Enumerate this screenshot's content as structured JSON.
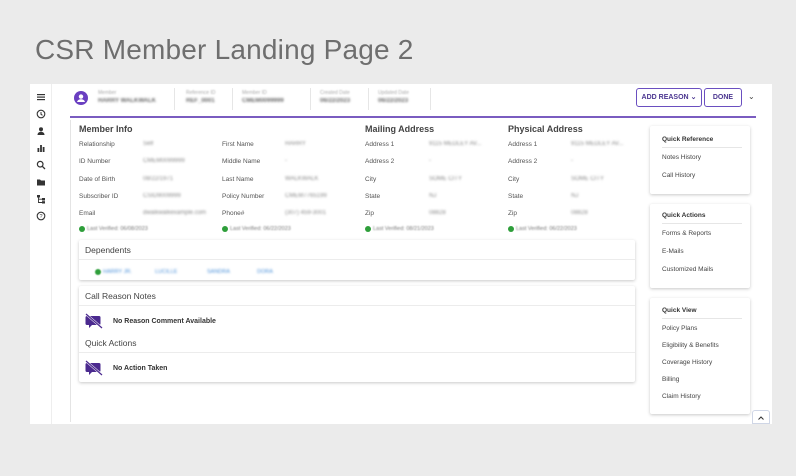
{
  "page_title": "CSR Member Landing Page 2",
  "header": {
    "fields": [
      {
        "label": "Member",
        "value": "HARRY WALKWALK"
      },
      {
        "label": "Reference ID",
        "value": "REF_0001"
      },
      {
        "label": "Member ID",
        "value": "CMEM0099999"
      },
      {
        "label": "Created Date",
        "value": "06/22/2023"
      },
      {
        "label": "Updated Date",
        "value": "06/22/2023"
      }
    ],
    "add_reason_label": "ADD REASON",
    "done_label": "DONE"
  },
  "member_info": {
    "title": "Member Info",
    "rows_left": [
      {
        "label": "Relationship",
        "value": "Self"
      },
      {
        "label": "ID Number",
        "value": "CMEM0099999"
      },
      {
        "label": "Date of Birth",
        "value": "08/22/1971"
      },
      {
        "label": "Subscriber ID",
        "value": "CSID9009999"
      },
      {
        "label": "Email",
        "value": "dwalkwalkexample.com"
      }
    ],
    "rows_right": [
      {
        "label": "First Name",
        "value": "HARRY"
      },
      {
        "label": "Middle Name",
        "value": "-"
      },
      {
        "label": "Last Name",
        "value": "WALKWALK"
      },
      {
        "label": "Policy Number",
        "value": "CMEM7765199"
      },
      {
        "label": "Phone#",
        "value": "(307) 459-3001"
      }
    ],
    "verified_left": "Last Verified: 06/08/2023",
    "verified_right": "Last Verified: 06/22/2023"
  },
  "mailing_address": {
    "title": "Mailing Address",
    "rows": [
      {
        "label": "Address 1",
        "value": "9115 MEDLEY AV..."
      },
      {
        "label": "Address 2",
        "value": "-"
      },
      {
        "label": "City",
        "value": "SOME CITY"
      },
      {
        "label": "State",
        "value": "NJ"
      },
      {
        "label": "Zip",
        "value": "08828"
      }
    ],
    "verified": "Last Verified: 08/21/2023"
  },
  "physical_address": {
    "title": "Physical Address",
    "rows": [
      {
        "label": "Address 1",
        "value": "9115 MEDLEY AV..."
      },
      {
        "label": "Address 2",
        "value": "-"
      },
      {
        "label": "City",
        "value": "SOME CITY"
      },
      {
        "label": "State",
        "value": "NJ"
      },
      {
        "label": "Zip",
        "value": "08828"
      }
    ],
    "verified": "Last Verified: 06/22/2023"
  },
  "dependents": {
    "title": "Dependents",
    "items": [
      "HARRY JR.",
      "LUCILLE",
      "SANDRA",
      "DORA"
    ]
  },
  "call_reason_notes": {
    "title": "Call Reason Notes",
    "empty_message": "No Reason Comment Available"
  },
  "quick_actions_main": {
    "title": "Quick Actions",
    "empty_message": "No Action Taken"
  },
  "side_quick_reference": {
    "title": "Quick Reference",
    "items": [
      "Notes History",
      "Call History"
    ]
  },
  "side_quick_actions": {
    "title": "Quick Actions",
    "items": [
      "Forms & Reports",
      "E-Mails",
      "Customized Mails"
    ]
  },
  "side_quick_view": {
    "title": "Quick View",
    "items": [
      "Policy Plans",
      "Eligibility & Benefits",
      "Coverage History",
      "Billing",
      "Claim History"
    ]
  },
  "rail_icons": [
    "menu-icon",
    "history-icon",
    "person-icon",
    "bar-chart-icon",
    "search-icon",
    "folder-icon",
    "hierarchy-icon",
    "help-icon"
  ],
  "colors": {
    "accent": "#6a3fc1",
    "verified": "#2e9e3a",
    "link": "#4a90d9"
  }
}
